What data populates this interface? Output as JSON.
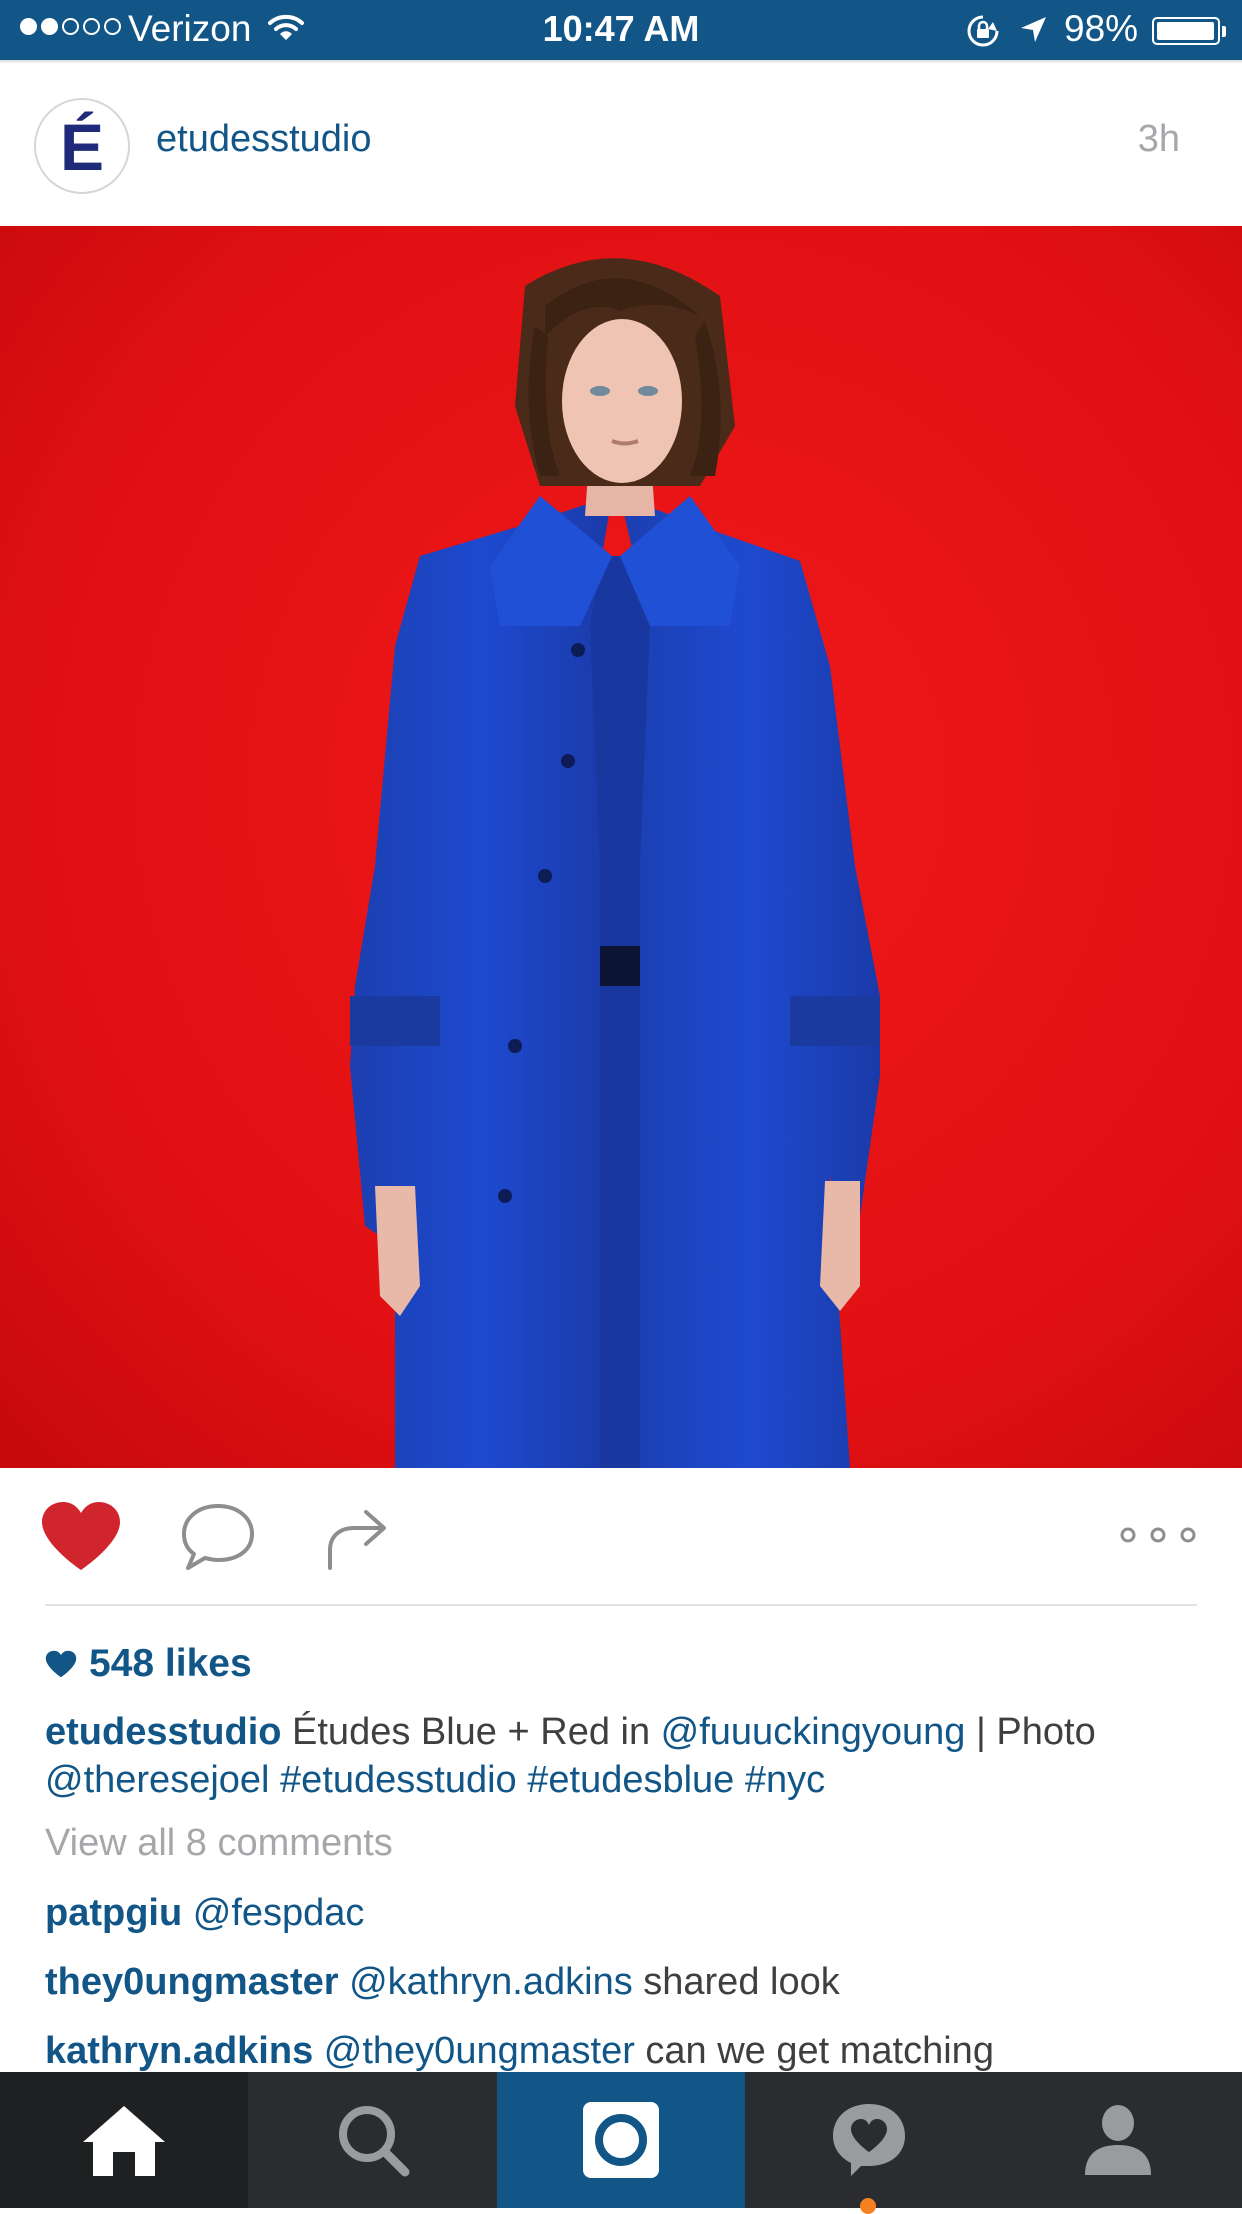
{
  "status_bar": {
    "carrier": "Verizon",
    "time": "10:47 AM",
    "battery_percent": "98%",
    "battery_level": 0.98,
    "signal_bars_filled": 2,
    "signal_bars_total": 5
  },
  "post": {
    "avatar_letter": "É",
    "username": "etudesstudio",
    "time_ago": "3h",
    "liked": true,
    "likes": "548 likes",
    "caption": {
      "author": "etudesstudio",
      "text_1": " Études Blue + Red in ",
      "mention_1": "@fuuuckingyoung",
      "text_2": " | Photo ",
      "mention_2": "@theresejoel",
      "hashtag_1": "#etudesstudio",
      "hashtag_2": "#etudesblue",
      "hashtag_3": "#nyc"
    },
    "view_all_comments": "View all 8 comments",
    "comments": [
      {
        "user": "patpgiu",
        "mention": "@fespdac",
        "text": ""
      },
      {
        "user": "they0ungmaster",
        "mention": "@kathryn.adkins",
        "text": " shared look"
      },
      {
        "user": "kathryn.adkins",
        "mention": "@they0ungmaster",
        "text": " can we get matching"
      }
    ]
  },
  "tab_bar": {
    "tabs": [
      {
        "name": "home",
        "icon": "home-icon",
        "active": true
      },
      {
        "name": "search",
        "icon": "search-icon",
        "active": false
      },
      {
        "name": "camera",
        "icon": "camera-icon",
        "active": false
      },
      {
        "name": "activity",
        "icon": "activity-heart-icon",
        "active": false,
        "has_notification": true
      },
      {
        "name": "profile",
        "icon": "profile-icon",
        "active": false
      }
    ]
  },
  "colors": {
    "accent_blue": "#125688",
    "like_red": "#d1252d",
    "tab_bar_bg": "#2a2c2f",
    "notification_orange": "#f58120"
  }
}
